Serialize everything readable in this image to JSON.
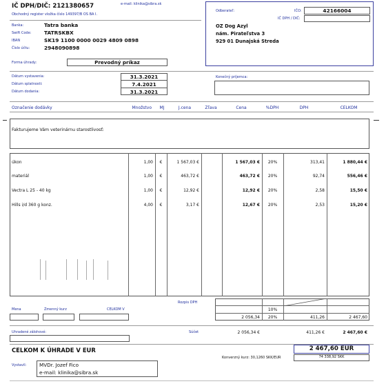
{
  "supplier": {
    "ic_dph_label": "IČ DPH/DIČ:",
    "ic_dph_value": "2121380657",
    "email_header": "e-mail: klinika@sibra.sk",
    "register": "Obchodný register vložka číslo 149397/B OS BA I.",
    "bank_label": "Banka:",
    "bank_value": "Tatra banka",
    "swift_label": "Swift Code:",
    "swift_value": "TATRSKBX",
    "iban_label": "IBAN",
    "iban_value": "SK19 1100 0000 0029 4809 0898",
    "account_label": "Číslo účtu:",
    "account_value": "2948090898"
  },
  "customer": {
    "label": "Odberateľ:",
    "ico_label": "IČO:",
    "ico_value": "42166004",
    "icdph_label": "IČ DPH / DIČ:",
    "icdph_value": "",
    "name": "OZ Dog Azyl",
    "street": "nám. Pirateľstva 3",
    "city": "929 01 Dunajská Streda"
  },
  "payment": {
    "label": "Forma úhrady:",
    "value": "Prevodný príkaz"
  },
  "dates": {
    "issue_label": "Dátum vystavenia:",
    "issue_value": "31.3.2021",
    "due_label": "Dátum splatnosti:",
    "due_value": "7.4.2021",
    "delivery_label": "Dátum dodania:",
    "delivery_value": "31.3.2021"
  },
  "final_recipient_label": "Konečný príjemca:",
  "columns": {
    "item": "Označenie dodávky",
    "qty": "Množstvo",
    "unit": "MJ",
    "unit_price": "J.cena",
    "discount": "Zľava",
    "price": "Cena",
    "vat_pct": "%DPH",
    "vat": "DPH",
    "total": "CELKOM"
  },
  "intro_text": "Fakturujeme Vám veterinárnu starostlivosť:",
  "items": [
    {
      "name": "úkon",
      "qty": "1,00",
      "unit": "€",
      "unit_price": "1 567,03 €",
      "price": "1 567,03 €",
      "vat_pct": "20%",
      "vat": "313,41",
      "total": "1 880,44 €"
    },
    {
      "name": "materiál",
      "qty": "1,00",
      "unit": "€",
      "unit_price": "463,72 €",
      "price": "463,72 €",
      "vat_pct": "20%",
      "vat": "92,74",
      "total": "556,46 €"
    },
    {
      "name": "Vectra L 25 - 40 kg",
      "qty": "1,00",
      "unit": "€",
      "unit_price": "12,92 €",
      "price": "12,92 €",
      "vat_pct": "20%",
      "vat": "2,58",
      "total": "15,50 €"
    },
    {
      "name": "Hills i/d 360 g konz.",
      "qty": "4,00",
      "unit": "€",
      "unit_price": "3,17 €",
      "price": "12,67 €",
      "vat_pct": "20%",
      "vat": "2,53",
      "total": "15,20 €"
    }
  ],
  "summary": {
    "rozpis_label": "Rozpis DPH",
    "currency_label": "Mena",
    "rate_label": "Zmenný kurz",
    "total_v_label": "CELKOM V",
    "vat10": "10%",
    "base20": "2 056,34",
    "vat20": "20%",
    "vat20_amount": "411,26",
    "total20": "2 467,60",
    "advances_label": "Uhradené zálohové:",
    "sum_label": "Súčet",
    "sum_base": "2 056,34 €",
    "sum_vat": "411,26 €",
    "sum_total": "2 467,60 €"
  },
  "grand": {
    "label": "CELKOM K ÚHRADE V EUR",
    "value": "2 467,60 EUR",
    "conv_rate": "Konverzný kurz: 30,1260 SKK/EUR",
    "skk_value": "74 338,92 SKK"
  },
  "issuer": {
    "label": "Vystavil:",
    "name": "MVDr. Jozef Fico",
    "email": "e-mail: klinika@sibra.sk"
  }
}
